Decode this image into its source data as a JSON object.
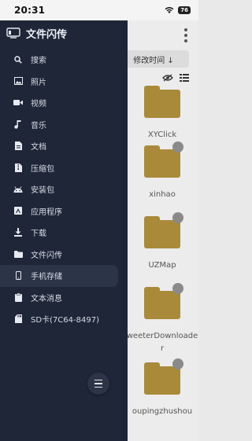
{
  "status_bar": {
    "time": "20:31",
    "battery": "76"
  },
  "drawer": {
    "title": "文件闪传",
    "items": [
      {
        "label": "搜索",
        "icon": "search-icon"
      },
      {
        "label": "照片",
        "icon": "photo-icon"
      },
      {
        "label": "视频",
        "icon": "video-icon"
      },
      {
        "label": "音乐",
        "icon": "music-icon"
      },
      {
        "label": "文档",
        "icon": "document-icon"
      },
      {
        "label": "压缩包",
        "icon": "archive-icon"
      },
      {
        "label": "安装包",
        "icon": "android-icon"
      },
      {
        "label": "应用程序",
        "icon": "app-icon"
      },
      {
        "label": "下载",
        "icon": "download-icon"
      },
      {
        "label": "文件闪传",
        "icon": "folder-icon"
      },
      {
        "label": "手机存储",
        "icon": "phone-icon",
        "active": true
      },
      {
        "label": "文本消息",
        "icon": "clipboard-icon"
      },
      {
        "label": "SD卡(7C64-8497)",
        "icon": "sd-card-icon"
      }
    ]
  },
  "background": {
    "sort_label": "修改时间 ↓",
    "files": [
      {
        "name": "XYClick"
      },
      {
        "name": "xinhao"
      },
      {
        "name": "UZMap"
      },
      {
        "name": "weeterDownloader"
      },
      {
        "name": "oupingzhushou"
      }
    ]
  },
  "colors": {
    "drawer_bg": "#1e2637",
    "active_item_bg": "#2c3547",
    "folder": "#a98a3a"
  }
}
